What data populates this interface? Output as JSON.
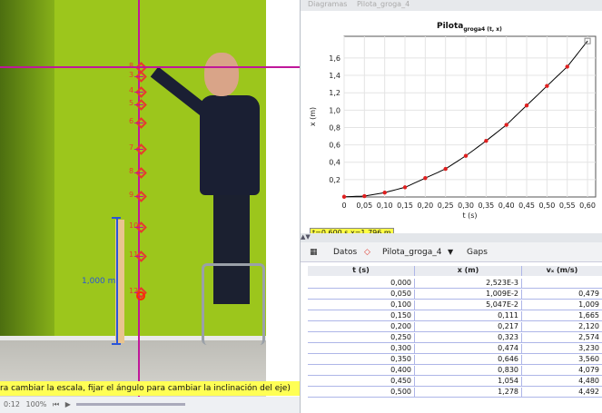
{
  "video": {
    "meter_label": "1,000 m",
    "point_labels": [
      "8",
      "3",
      "4",
      "5",
      "6",
      "7",
      "8",
      "9",
      "10",
      "11",
      "12"
    ],
    "status_text": "ra cambiar la escala, fijar el ángulo para cambiar la inclinación del eje)",
    "bottom": {
      "frame": "0:12",
      "zoom": "100%"
    }
  },
  "tabs": {
    "diagramas": "Diagramas",
    "pilota": "Pilota_groga_4"
  },
  "chart_data": {
    "type": "line",
    "title": "Pilota",
    "title_sub": "groga4 (t, x)",
    "xlabel": "t (s)",
    "ylabel": "x (m)",
    "x": [
      0,
      0.05,
      0.1,
      0.15,
      0.2,
      0.25,
      0.3,
      0.35,
      0.4,
      0.45,
      0.5,
      0.55,
      0.6
    ],
    "y": [
      0.0025,
      0.01,
      0.05,
      0.111,
      0.217,
      0.323,
      0.474,
      0.646,
      0.83,
      1.054,
      1.278,
      1.5,
      1.796
    ],
    "xticks": [
      "0",
      "0,05",
      "0,10",
      "0,15",
      "0,20",
      "0,25",
      "0,30",
      "0,35",
      "0,40",
      "0,45",
      "0,50",
      "0,55",
      "0,60"
    ],
    "yticks": [
      "0,2",
      "0,4",
      "0,6",
      "0,8",
      "1,0",
      "1,2",
      "1,4",
      "1,6"
    ],
    "xlim": [
      0,
      0.62
    ],
    "ylim": [
      0,
      1.85
    ],
    "point_color": "#e02020",
    "line_color": "#000000"
  },
  "readout": "t=0,600 s  x=1,796 m",
  "tablebar": {
    "datos": "Datos",
    "dataset": "Pilota_groga_4",
    "gaps": "Gaps"
  },
  "table": {
    "headers": [
      "t (s)",
      "x (m)",
      "vₓ (m/s)"
    ],
    "rows": [
      [
        "0,000",
        "2,523E-3",
        ""
      ],
      [
        "0,050",
        "1,009E-2",
        "0,479"
      ],
      [
        "0,100",
        "5,047E-2",
        "1,009"
      ],
      [
        "0,150",
        "0,111",
        "1,665"
      ],
      [
        "0,200",
        "0,217",
        "2,120"
      ],
      [
        "0,250",
        "0,323",
        "2,574"
      ],
      [
        "0,300",
        "0,474",
        "3,230"
      ],
      [
        "0,350",
        "0,646",
        "3,560"
      ],
      [
        "0,400",
        "0,830",
        "4,079"
      ],
      [
        "0,450",
        "1,054",
        "4,480"
      ],
      [
        "0,500",
        "1,278",
        "4,492"
      ]
    ]
  }
}
